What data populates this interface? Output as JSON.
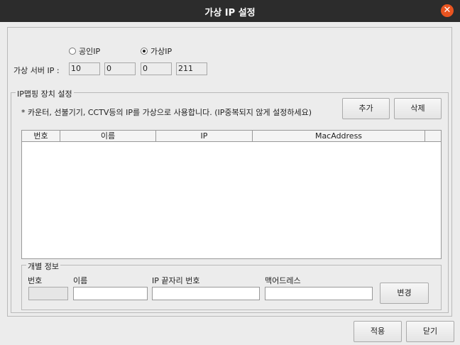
{
  "window": {
    "title": "가상 IP 설정",
    "close_glyph": "✕"
  },
  "mode": {
    "public_label": "공인IP",
    "virtual_label": "가상IP",
    "selected": "virtual"
  },
  "server": {
    "label": "가상 서버 IP :",
    "octets": [
      "10",
      "0",
      "0",
      "211"
    ]
  },
  "mapping": {
    "legend": "IP맵핑 장치 설정",
    "notice": "* 카운터, 선불기기, CCTV등의 IP를 가상으로 사용합니다. (IP중복되지 않게 설정하세요)",
    "add_label": "추가",
    "delete_label": "삭제",
    "columns": [
      "번호",
      "이름",
      "IP",
      "MacAddress"
    ],
    "rows": []
  },
  "detail": {
    "legend": "개별 정보",
    "number_label": "번호",
    "name_label": "이름",
    "ip_last_label": "IP 끝자리 번호",
    "mac_label": "맥어드레스",
    "number_value": "",
    "name_value": "",
    "ip_last_value": "",
    "mac_value": "",
    "change_label": "변경"
  },
  "footer": {
    "apply_label": "적용",
    "close_label": "닫기"
  }
}
